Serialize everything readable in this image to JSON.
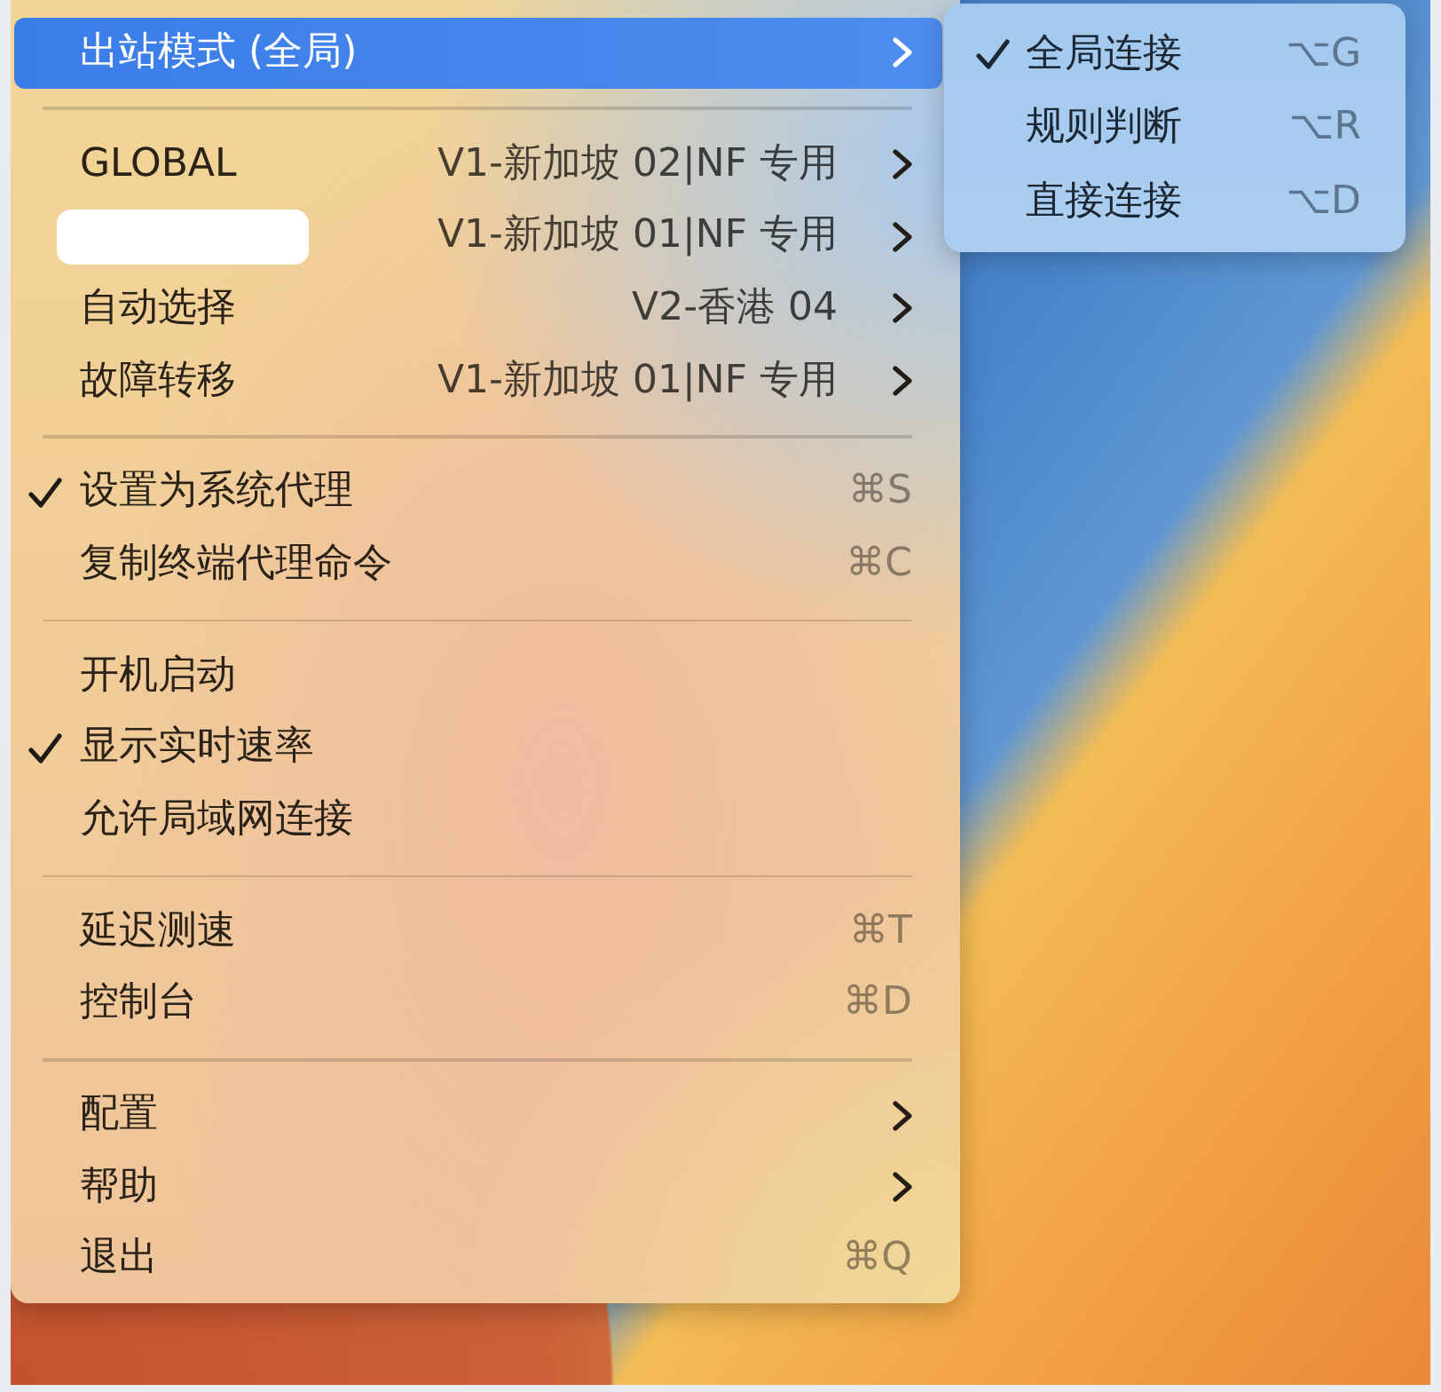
{
  "main_menu": {
    "sections": [
      {
        "items": [
          {
            "kind": "submenu",
            "label": "出站模式 (全局)",
            "highlighted": true
          }
        ]
      },
      {
        "items": [
          {
            "kind": "proxy_group",
            "label": "GLOBAL",
            "redacted": false,
            "value": "V1-新加坡 02|NF 专用",
            "highlighted": false
          },
          {
            "kind": "proxy_group",
            "redacted": true,
            "value": "V1-新加坡 01|NF 专用",
            "highlighted": false
          },
          {
            "kind": "proxy_group",
            "label": "自动选择",
            "redacted": false,
            "value": "V2-香港 04",
            "highlighted": false
          },
          {
            "kind": "proxy_group",
            "label": "故障转移",
            "redacted": false,
            "value": "V1-新加坡 01|NF 专用",
            "highlighted": false
          }
        ]
      },
      {
        "items": [
          {
            "kind": "toggle",
            "label": "设置为系统代理",
            "checked": true,
            "shortcut": "⌘S",
            "highlighted": false
          },
          {
            "kind": "action",
            "label": "复制终端代理命令",
            "shortcut": "⌘C",
            "highlighted": false
          }
        ]
      },
      {
        "items": [
          {
            "kind": "toggle",
            "label": "开机启动",
            "checked": false,
            "highlighted": false
          },
          {
            "kind": "toggle",
            "label": "显示实时速率",
            "checked": true,
            "highlighted": false
          },
          {
            "kind": "toggle",
            "label": "允许局域网连接",
            "checked": false,
            "highlighted": false
          }
        ]
      },
      {
        "items": [
          {
            "kind": "action",
            "label": "延迟测速",
            "shortcut": "⌘T",
            "highlighted": false
          },
          {
            "kind": "action",
            "label": "控制台",
            "shortcut": "⌘D",
            "highlighted": false
          }
        ]
      },
      {
        "items": [
          {
            "kind": "submenu",
            "label": "配置",
            "highlighted": false
          },
          {
            "kind": "submenu",
            "label": "帮助",
            "highlighted": false
          },
          {
            "kind": "action",
            "label": "退出",
            "shortcut": "⌘Q",
            "highlighted": false
          }
        ]
      }
    ]
  },
  "outbound_submenu": {
    "items": [
      {
        "label": "全局连接",
        "selected": true,
        "shortcut": "⌥G"
      },
      {
        "label": "规则判断",
        "selected": false,
        "shortcut": "⌥R"
      },
      {
        "label": "直接连接",
        "selected": false,
        "shortcut": "⌥D"
      }
    ]
  }
}
